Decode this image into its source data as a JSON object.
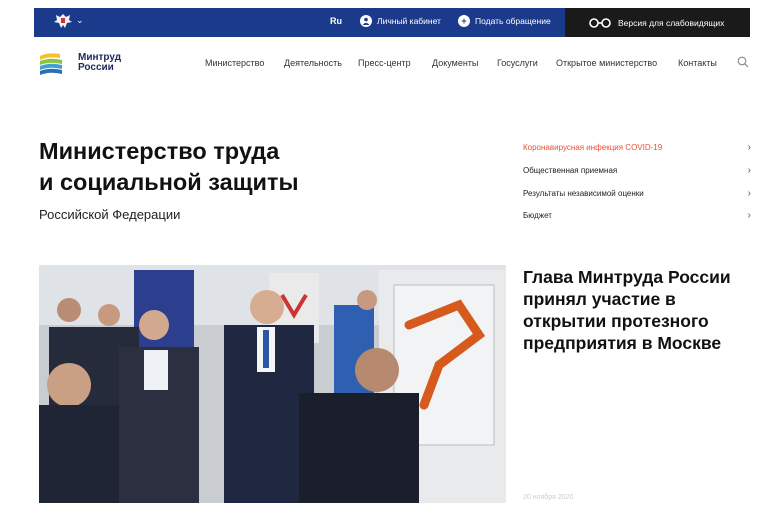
{
  "topbar": {
    "lang": "Ru",
    "cabinet_label": "Личный кабинет",
    "appeal_label": "Подать обращение",
    "vision_label": "Версия для слабовидящих"
  },
  "logo": {
    "line1": "Минтруд",
    "line2": "России"
  },
  "nav": [
    "Министерство",
    "Деятельность",
    "Пресс-центр",
    "Документы",
    "Госуслуги",
    "Открытое министерство",
    "Контакты"
  ],
  "hero": {
    "title_line1": "Министерство труда",
    "title_line2": "и социальной защиты",
    "subtitle": "Российской Федерации"
  },
  "quick_links": [
    "Коронавирусная инфекция COVID-19",
    "Общественная приемная",
    "Результаты независимой оценки",
    "Бюджет"
  ],
  "news": {
    "headline": "Глава Минтруда России принял участие в открытии протезного предприятия в Москве",
    "date": "20 ноября 2020"
  },
  "colors": {
    "brand_blue": "#1b3a8c",
    "accent_red": "#e8503a",
    "dark": "#1a1a1a"
  },
  "icons": [
    "emblem-icon",
    "chevron-down-icon",
    "user-icon",
    "plus-icon",
    "glasses-icon",
    "search-icon",
    "chevron-right-icon"
  ]
}
